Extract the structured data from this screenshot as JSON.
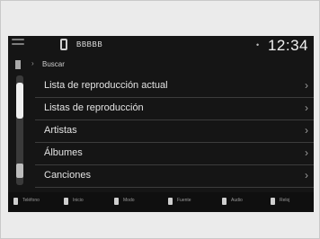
{
  "status_bar": {
    "device_name": "BBBBB",
    "time": "12:34",
    "signal_indicator": "•"
  },
  "breadcrumb": {
    "label": "Buscar"
  },
  "menu": {
    "items": [
      {
        "label": "Lista de reproducción actual"
      },
      {
        "label": "Listas de reproducción"
      },
      {
        "label": "Artistas"
      },
      {
        "label": "Álbumes"
      },
      {
        "label": "Canciones"
      }
    ],
    "chevron": "›"
  },
  "bottom_bar": {
    "items": [
      "Teléfono",
      "Inicio",
      "Modo",
      "Fuente",
      "Audio",
      "Reloj"
    ]
  },
  "colors": {
    "screen_bg": "#151515",
    "frame_bg": "#ebebeb",
    "text": "#e3e3e3",
    "divider": "#3c3c3c"
  }
}
